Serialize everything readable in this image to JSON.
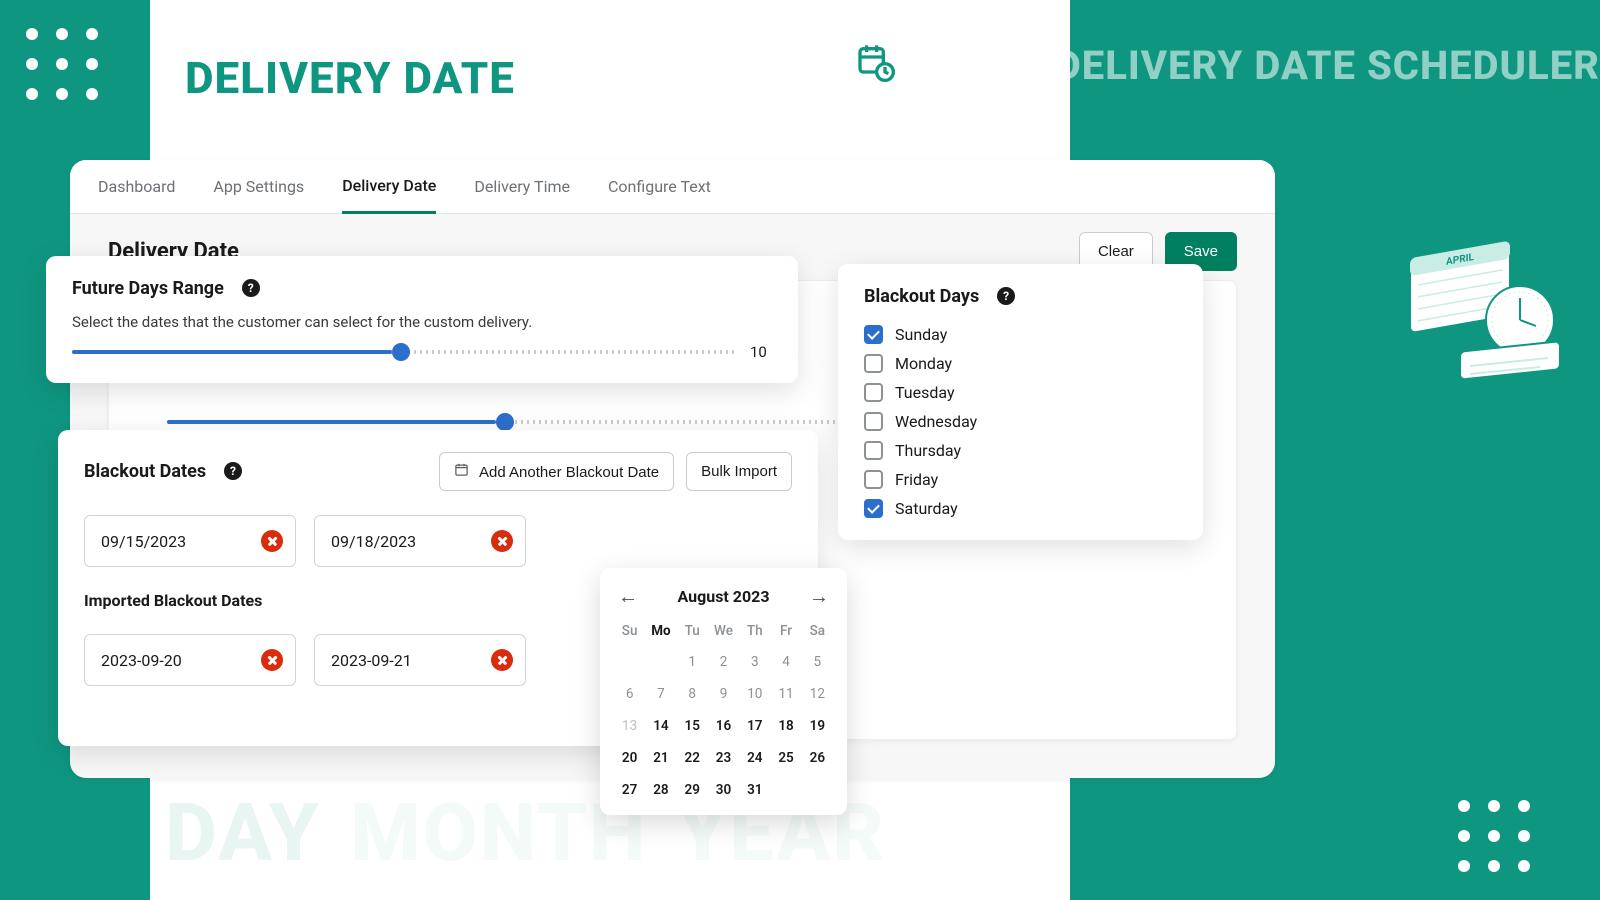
{
  "page_title": "DELIVERY DATE",
  "brand_title": "EM DELIVERY DATE SCHEDULER",
  "bg_words": {
    "w1": "DAY",
    "w2": "MONTH",
    "w3": "YEAR"
  },
  "tabs": [
    {
      "label": "Dashboard",
      "active": false
    },
    {
      "label": "App Settings",
      "active": false
    },
    {
      "label": "Delivery Date",
      "active": true
    },
    {
      "label": "Delivery Time",
      "active": false
    },
    {
      "label": "Configure Text",
      "active": false
    }
  ],
  "panel_heading": "Delivery Date",
  "actions": {
    "clear": "Clear",
    "save": "Save"
  },
  "future": {
    "title": "Future Days Range",
    "desc": "Select the dates that the customer can select for the custom delivery.",
    "value": "10",
    "percent": 48
  },
  "bg_slider_value": "10",
  "blackout_dates": {
    "title": "Blackout Dates",
    "add_label": "Add Another Blackout Date",
    "bulk_label": "Bulk Import",
    "dates": [
      "09/15/2023",
      "09/18/2023"
    ],
    "imported_title": "Imported Blackout Dates",
    "imported": [
      "2023-09-20",
      "2023-09-21"
    ]
  },
  "blackout_days": {
    "title": "Blackout Days",
    "days": [
      {
        "label": "Sunday",
        "checked": true
      },
      {
        "label": "Monday",
        "checked": false
      },
      {
        "label": "Tuesday",
        "checked": false
      },
      {
        "label": "Wednesday",
        "checked": false
      },
      {
        "label": "Thursday",
        "checked": false
      },
      {
        "label": "Friday",
        "checked": false
      },
      {
        "label": "Saturday",
        "checked": true
      }
    ]
  },
  "calendar": {
    "title": "August 2023",
    "dow": [
      "Su",
      "Mo",
      "Tu",
      "We",
      "Th",
      "Fr",
      "Sa"
    ],
    "today_col": 1,
    "leading_blanks": 2,
    "days": [
      {
        "n": 1,
        "a": false
      },
      {
        "n": 2,
        "a": false
      },
      {
        "n": 3,
        "a": false
      },
      {
        "n": 4,
        "a": false
      },
      {
        "n": 5,
        "a": false
      },
      {
        "n": 6,
        "a": false
      },
      {
        "n": 7,
        "a": false
      },
      {
        "n": 8,
        "a": false
      },
      {
        "n": 9,
        "a": false
      },
      {
        "n": 10,
        "a": false
      },
      {
        "n": 11,
        "a": false
      },
      {
        "n": 12,
        "a": false
      },
      {
        "n": 13,
        "a": false,
        "dim": true
      },
      {
        "n": 14,
        "a": true
      },
      {
        "n": 15,
        "a": true
      },
      {
        "n": 16,
        "a": true
      },
      {
        "n": 17,
        "a": true
      },
      {
        "n": 18,
        "a": true
      },
      {
        "n": 19,
        "a": true
      },
      {
        "n": 20,
        "a": true
      },
      {
        "n": 21,
        "a": true
      },
      {
        "n": 22,
        "a": true
      },
      {
        "n": 23,
        "a": true
      },
      {
        "n": 24,
        "a": true
      },
      {
        "n": 25,
        "a": true
      },
      {
        "n": 26,
        "a": true
      },
      {
        "n": 27,
        "a": true
      },
      {
        "n": 28,
        "a": true
      },
      {
        "n": 29,
        "a": true
      },
      {
        "n": 30,
        "a": true
      },
      {
        "n": 31,
        "a": true
      }
    ]
  }
}
